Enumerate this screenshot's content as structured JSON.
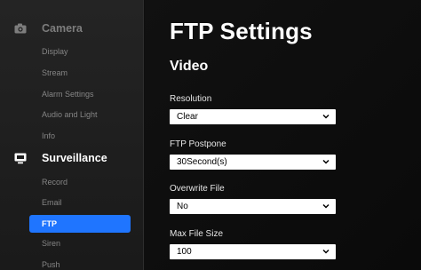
{
  "sidebar": {
    "camera": {
      "label": "Camera",
      "icon": "camera-icon",
      "items": [
        {
          "label": "Display"
        },
        {
          "label": "Stream"
        },
        {
          "label": "Alarm Settings"
        },
        {
          "label": "Audio and Light"
        },
        {
          "label": "Info"
        }
      ]
    },
    "surveillance": {
      "label": "Surveillance",
      "icon": "monitor-icon",
      "items": [
        {
          "label": "Record"
        },
        {
          "label": "Email"
        },
        {
          "label": "FTP",
          "active": true
        },
        {
          "label": "Siren"
        },
        {
          "label": "Push"
        }
      ]
    }
  },
  "main": {
    "title": "FTP Settings",
    "section": "Video",
    "fields": [
      {
        "label": "Resolution",
        "value": "Clear"
      },
      {
        "label": "FTP Postpone",
        "value": "30Second(s)"
      },
      {
        "label": "Overwrite File",
        "value": "No"
      },
      {
        "label": "Max File Size",
        "value": "100"
      }
    ]
  },
  "colors": {
    "accent": "#1f75ff",
    "sidebar_bg": "#222222",
    "main_bg": "#0f0f0f"
  }
}
